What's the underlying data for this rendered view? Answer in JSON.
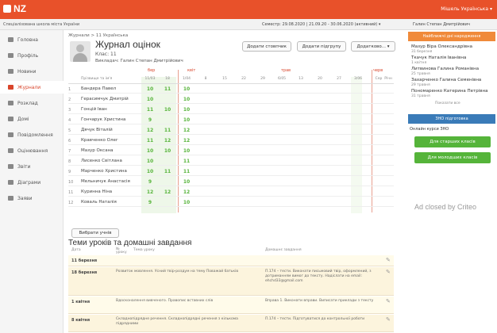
{
  "app": {
    "logo": "NZ",
    "top_user": "Мішель Українська ▾"
  },
  "subbar": {
    "school": "Спеціалізована школа міста України",
    "semester": "Семестр: 29.08.2020 | 21.09.20 - 30.06.2020 (активний) ▾",
    "user": "Галин Степан Дмитрійович"
  },
  "sidebar": {
    "items": [
      {
        "label": "Головна"
      },
      {
        "label": "Профіль"
      },
      {
        "label": "Новини"
      },
      {
        "label": "Журнали"
      },
      {
        "label": "Розклад"
      },
      {
        "label": "Домі"
      },
      {
        "label": "Повідомлення"
      },
      {
        "label": "Оцінювання"
      },
      {
        "label": "Звіти"
      },
      {
        "label": "Діаграми"
      },
      {
        "label": "Заяви"
      }
    ]
  },
  "header": {
    "breadcrumb": "Журнали > 11 Українська",
    "title": "Журнал оцінок",
    "class_name": "Клас: 11",
    "teacher": "Викладач: Галин Степан Дмитрійович",
    "btn_add_column": "Додати стовпчик",
    "btn_add_subgroup": "Додати підгрупу",
    "btn_more": "Додатково... ▾"
  },
  "grid": {
    "periods": [
      "бер",
      "квіт",
      "трав",
      "черв"
    ],
    "column_headers": [
      "Прізвище та ім'я",
      "11/03",
      "18",
      "1/04",
      "8",
      "15",
      "22",
      "29",
      "6/05",
      "13",
      "20",
      "27",
      "3/06",
      "Сер",
      "Річн"
    ],
    "rows": [
      {
        "num": "1",
        "name": "Бандера Павел",
        "g1": "10",
        "g2": "11",
        "g3": "10"
      },
      {
        "num": "2",
        "name": "Герасимчук Дмитрій",
        "g1": "10",
        "g2": "",
        "g3": "10"
      },
      {
        "num": "3",
        "name": "Гонцій Іван",
        "g1": "11",
        "g2": "10",
        "g3": "10"
      },
      {
        "num": "4",
        "name": "Гончарук Христина",
        "g1": "9",
        "g2": "",
        "g3": "10"
      },
      {
        "num": "5",
        "name": "Дячук Віталій",
        "g1": "12",
        "g2": "11",
        "g3": "12"
      },
      {
        "num": "6",
        "name": "Кравченко Олег",
        "g1": "11",
        "g2": "12",
        "g3": "12"
      },
      {
        "num": "7",
        "name": "Мазур Оксана",
        "g1": "10",
        "g2": "10",
        "g3": "10"
      },
      {
        "num": "8",
        "name": "Лисенко Світлана",
        "g1": "10",
        "g2": "",
        "g3": "11"
      },
      {
        "num": "9",
        "name": "Марченко Христина",
        "g1": "10",
        "g2": "11",
        "g3": "11"
      },
      {
        "num": "10",
        "name": "Мельничук Анастасія",
        "g1": "9",
        "g2": "",
        "g3": "10"
      },
      {
        "num": "11",
        "name": "Куринна Ніна",
        "g1": "12",
        "g2": "12",
        "g3": "12"
      },
      {
        "num": "12",
        "name": "Коваль Наталія",
        "g1": "9",
        "g2": "",
        "g3": "10"
      }
    ]
  },
  "pupils_btn": "Вибрати учнів",
  "lessons": {
    "title": "Теми уроків та домашні завдання",
    "col_date": "Дата",
    "col_num": "№ уроку",
    "col_topic": "Тема уроку",
    "col_hw": "Домашнє завдання",
    "items": [
      {
        "date": "11 березня",
        "topic": "",
        "hw": ""
      },
      {
        "date": "18 березня",
        "topic": "Розвиток мовлення. Усний твір-роздум на тему Поважай батьків",
        "hw": "П.174 – тести. Виконати письмовий твір, оформлений, з дотриманням вимог до тексту. Надіслати на email: ehchd33@gmail.com"
      },
      {
        "date": "1 квітня",
        "topic": "Вдосконалення вивченого. Правопис вставних слів",
        "hw": "Вправа 1. Виконати вправи. Виписати приклади з тексту"
      },
      {
        "date": "8 квітня",
        "topic": "Складнопідрядне речення. Складнопідрядні речення з кількома підрядними",
        "hw": "П.174 – тести. Підготуватися до контрольної роботи"
      }
    ]
  },
  "right": {
    "bday_head": "Найближчі дні народження",
    "bdays": [
      {
        "name": "Мазур Віра Олександрівна",
        "date": "31 березня"
      },
      {
        "name": "Ткачук Наталія Іванівна",
        "date": "1 квітня"
      },
      {
        "name": "Литвинова Галина Романівна",
        "date": "25 травня"
      },
      {
        "name": "Захарченко Галина Семенівна",
        "date": "29 травня"
      },
      {
        "name": "Пономаренко Катерина Петрівна",
        "date": "31 травня"
      }
    ],
    "bday_more": "Показати все",
    "zno_head": "ЗНО підготовка",
    "zno_text": "Онлайн курси ЗНО",
    "btn_older": "Для старших класів",
    "btn_younger": "Для молодших класів",
    "ad": "Ad closed by Criteo"
  },
  "colors": {
    "accent": "#e8512a",
    "grade_green": "#56b33a",
    "zno_blue": "#3a7bb8",
    "bday_orange": "#f08a3a"
  }
}
